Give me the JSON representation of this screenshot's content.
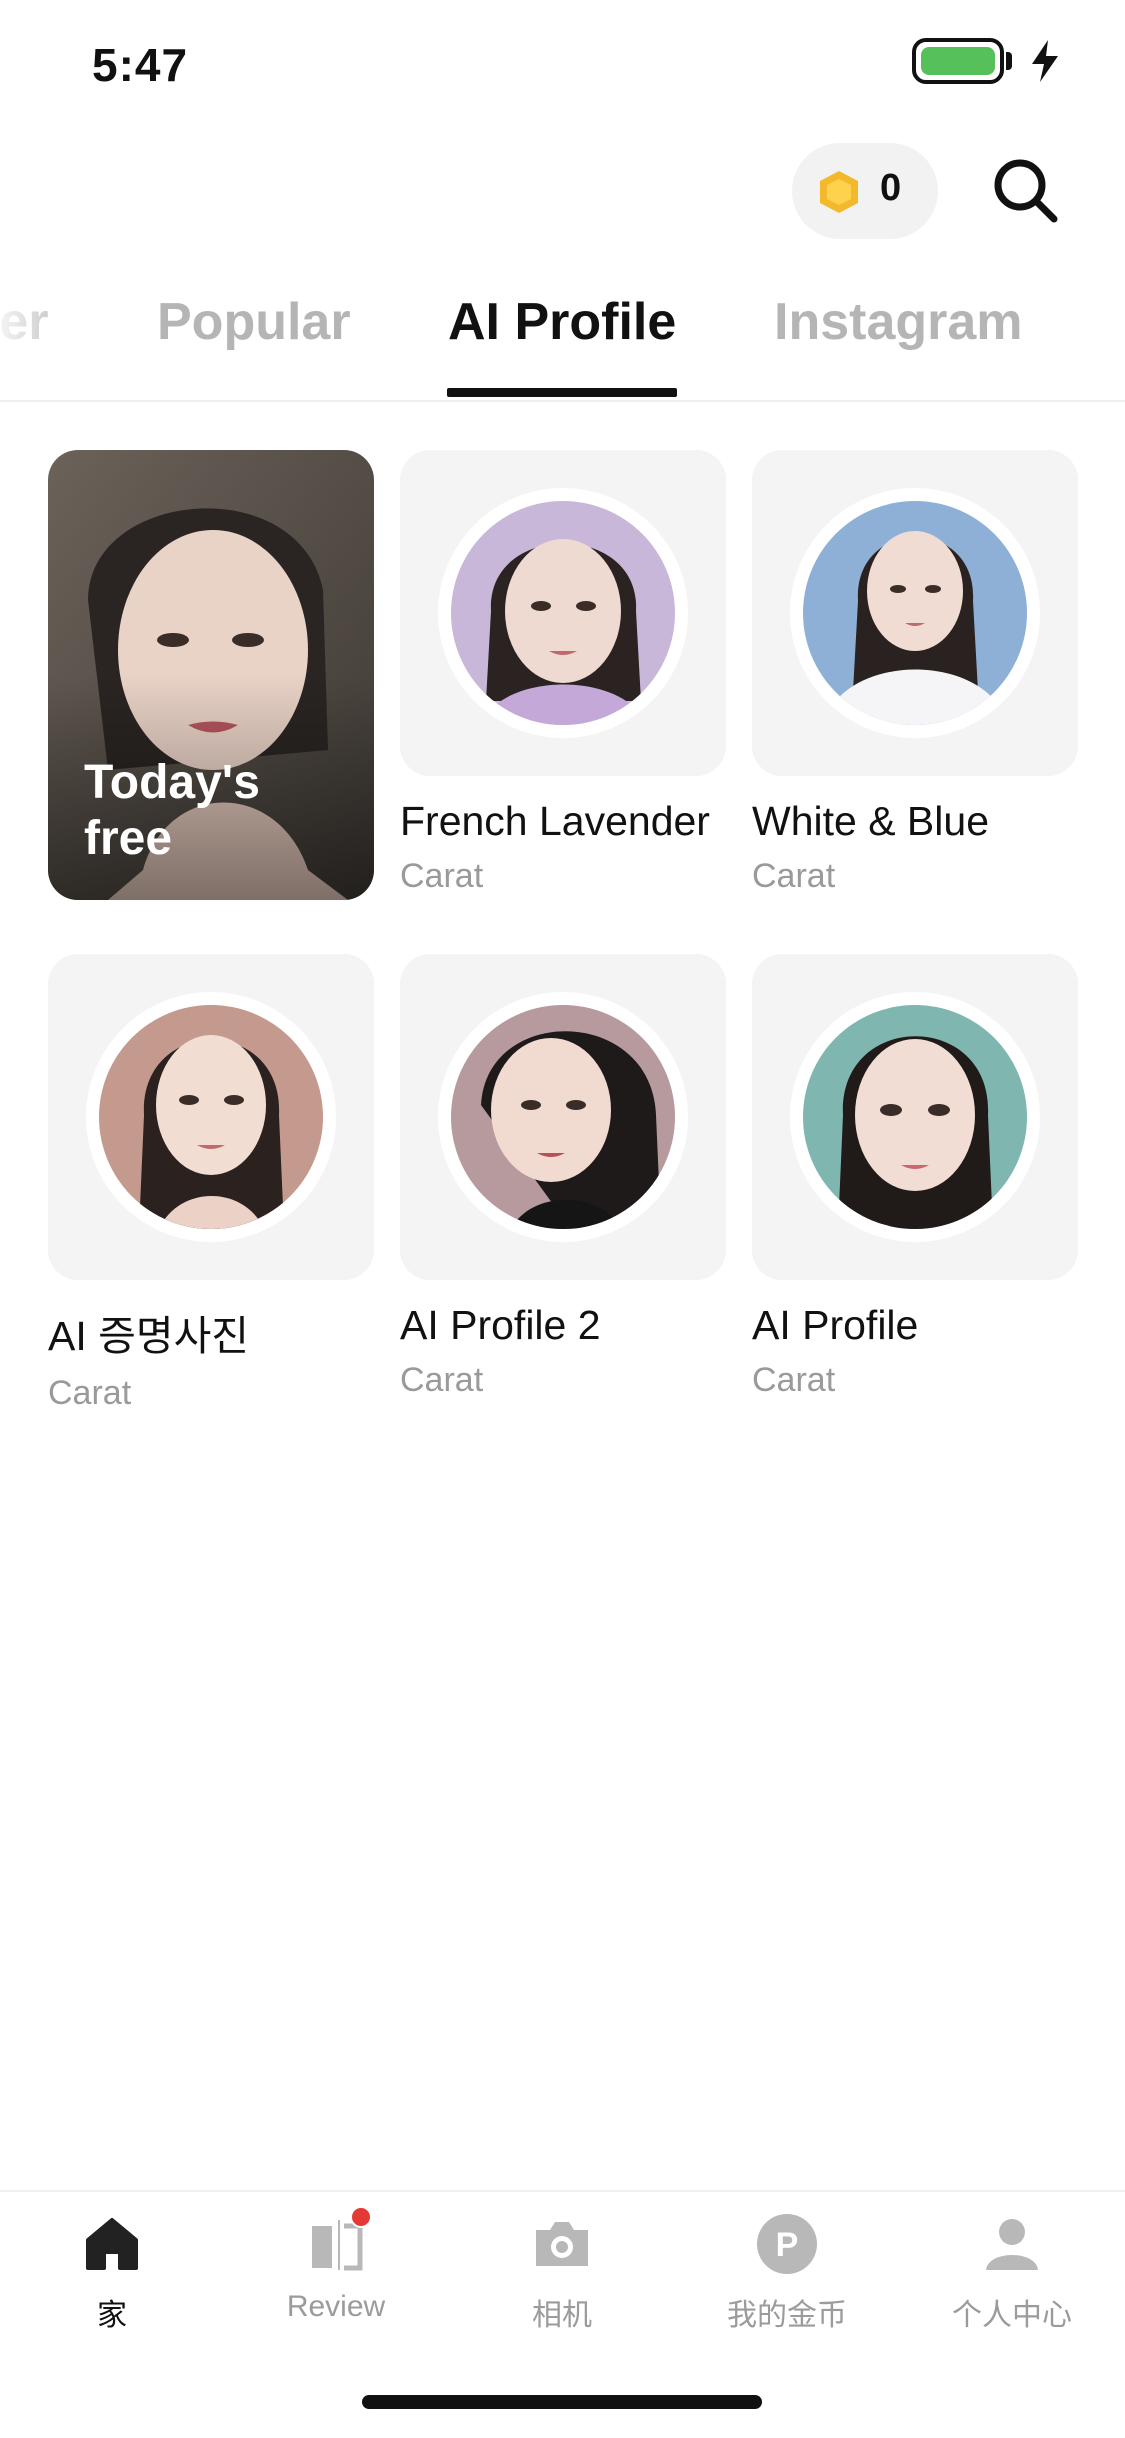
{
  "status_bar": {
    "time": "5:47"
  },
  "header": {
    "coin_count": "0"
  },
  "tabs": [
    {
      "label": "ter"
    },
    {
      "label": "Popular"
    },
    {
      "label": "AI Profile"
    },
    {
      "label": "Instagram"
    }
  ],
  "featured": {
    "text": "Today's free"
  },
  "cards": [
    {
      "title": "French Lavender",
      "subtitle": "Carat",
      "bg": "#c9b7d9"
    },
    {
      "title": "White & Blue",
      "subtitle": "Carat",
      "bg": "#8fb0d6"
    },
    {
      "title": "AI 증명사진",
      "subtitle": "Carat",
      "bg": "#c49a8e"
    },
    {
      "title": "AI Profile 2",
      "subtitle": "Carat",
      "bg": "#b79a9e"
    },
    {
      "title": "AI Profile",
      "subtitle": "Carat",
      "bg": "#7fb7b0"
    }
  ],
  "bottom_nav": [
    {
      "label": "家",
      "icon": "home-icon",
      "active": true
    },
    {
      "label": "Review",
      "icon": "review-icon",
      "active": false
    },
    {
      "label": "相机",
      "icon": "camera-icon",
      "active": false
    },
    {
      "label": "我的金币",
      "icon": "coin-p-icon",
      "active": false
    },
    {
      "label": "个人中心",
      "icon": "user-icon",
      "active": false
    }
  ],
  "colors": {
    "accent": "#111111",
    "muted": "#9a9a9a",
    "badge": "#e53935",
    "tile_bg": "#f4f4f4"
  }
}
